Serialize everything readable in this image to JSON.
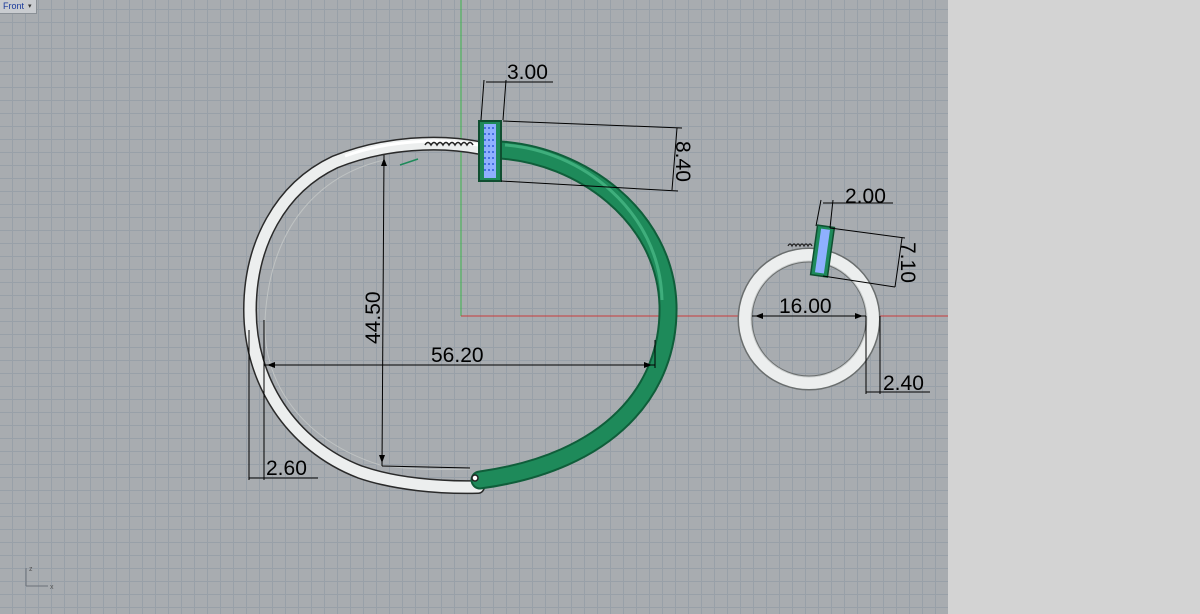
{
  "viewport": {
    "name": "Front",
    "axis_labels": {
      "z": "z",
      "x": "x"
    }
  },
  "colors": {
    "background": "#a8acb0",
    "grid": "#98a0a8",
    "x_axis": "#c83c3c",
    "y_axis": "#3cb44b",
    "metal": "#eceeee",
    "green_band": "#1e8a5a",
    "inlay": "#8fb0ff"
  },
  "dimensions": {
    "bangle_width": "56.20",
    "bangle_height": "44.50",
    "bangle_thickness": "2.60",
    "clasp_width": "3.00",
    "clasp_height": "8.40",
    "ring_diameter": "16.00",
    "ring_thickness": "2.40",
    "ring_clasp_width": "2.00",
    "ring_clasp_height": "7.10"
  }
}
